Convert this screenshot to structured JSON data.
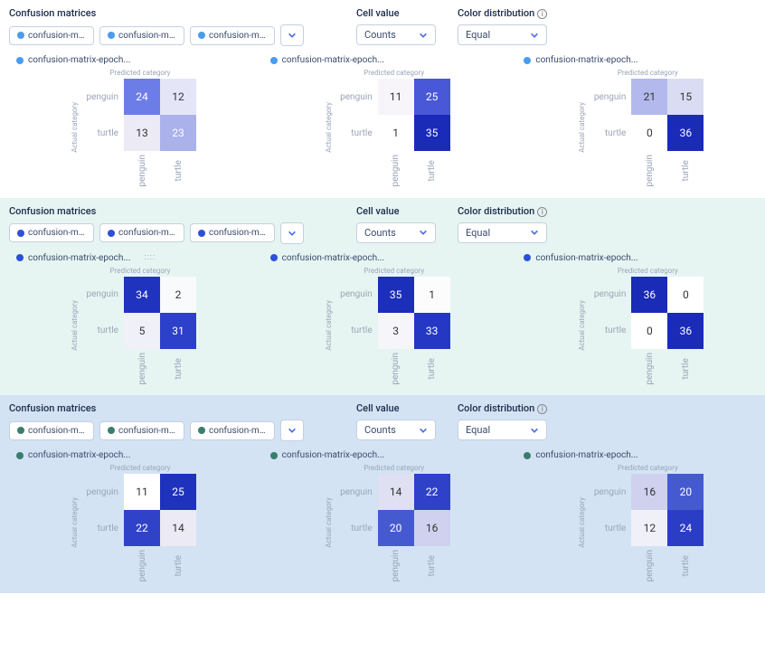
{
  "labels": {
    "confusion_matrices": "Confusion matrices",
    "cell_value": "Cell value",
    "color_distribution": "Color distribution",
    "predicted_category": "Predicted category",
    "actual_category": "Actual category",
    "pill_truncated": "confusion-matri...",
    "matrix_title_truncated": "confusion-matrix-epoch..."
  },
  "selects": {
    "cell_value": "Counts",
    "color_distribution": "Equal"
  },
  "colors": {
    "section1_dot": "#4a9cf0",
    "section2_dot": "#2e4fd9",
    "section3_dot": "#3a7d6f"
  },
  "sections": [
    {
      "bg": "bg-white",
      "dot": "#4a9cf0",
      "matrices": [
        {
          "cells": [
            24,
            12,
            13,
            23
          ],
          "colors": [
            "#6d7de8",
            "#e4e6f7",
            "#eceaf5",
            "#aab1eb"
          ],
          "text": [
            "#fff",
            "#333",
            "#333",
            "#fff"
          ]
        },
        {
          "cells": [
            11,
            25,
            1,
            35
          ],
          "colors": [
            "#f7f4fa",
            "#4858d6",
            "#ffffff",
            "#1a2bb8"
          ],
          "text": [
            "#333",
            "#fff",
            "#333",
            "#fff"
          ]
        },
        {
          "cells": [
            21,
            15,
            0,
            36
          ],
          "colors": [
            "#b3b9ec",
            "#dadcf3",
            "#ffffff",
            "#1a2bb8"
          ],
          "text": [
            "#333",
            "#333",
            "#333",
            "#fff"
          ]
        }
      ]
    },
    {
      "bg": "bg-teal",
      "dot": "#2e4fd9",
      "drag_first": true,
      "matrices": [
        {
          "cells": [
            34,
            2,
            5,
            31
          ],
          "colors": [
            "#1f33bf",
            "#f9fafc",
            "#f0f0f8",
            "#2d40c9"
          ],
          "text": [
            "#fff",
            "#333",
            "#333",
            "#fff"
          ]
        },
        {
          "cells": [
            35,
            1,
            3,
            33
          ],
          "colors": [
            "#1b2fbb",
            "#fcfcfd",
            "#f6f6fa",
            "#2438c3"
          ],
          "text": [
            "#fff",
            "#333",
            "#333",
            "#fff"
          ]
        },
        {
          "cells": [
            36,
            0,
            0,
            36
          ],
          "colors": [
            "#1a2bb8",
            "#ffffff",
            "#ffffff",
            "#1a2bb8"
          ],
          "text": [
            "#fff",
            "#333",
            "#333",
            "#fff"
          ]
        }
      ]
    },
    {
      "bg": "bg-blue",
      "dot": "#3a7d6f",
      "matrices": [
        {
          "cells": [
            11,
            25,
            22,
            14
          ],
          "colors": [
            "#ffffff",
            "#1e32bd",
            "#2f42c8",
            "#eceaf5"
          ],
          "text": [
            "#333",
            "#fff",
            "#fff",
            "#333"
          ]
        },
        {
          "cells": [
            14,
            22,
            20,
            16
          ],
          "colors": [
            "#e0e0f3",
            "#2e41c8",
            "#465ad0",
            "#cfd1ef"
          ],
          "text": [
            "#333",
            "#fff",
            "#fff",
            "#333"
          ]
        },
        {
          "cells": [
            16,
            20,
            12,
            24
          ],
          "colors": [
            "#cfd1ef",
            "#465ad0",
            "#f0f0f8",
            "#2b3dc5"
          ],
          "text": [
            "#333",
            "#fff",
            "#333",
            "#fff"
          ]
        }
      ]
    }
  ],
  "categories": [
    "penguin",
    "turtle"
  ],
  "chart_data": [
    {
      "run": 1,
      "matrix_index": 1,
      "type": "heatmap",
      "title": "confusion-matrix-epoch...",
      "xlabel": "Predicted category",
      "ylabel": "Actual category",
      "x": [
        "penguin",
        "turtle"
      ],
      "y": [
        "penguin",
        "turtle"
      ],
      "values": [
        [
          24,
          12
        ],
        [
          13,
          23
        ]
      ]
    },
    {
      "run": 1,
      "matrix_index": 2,
      "type": "heatmap",
      "title": "confusion-matrix-epoch...",
      "xlabel": "Predicted category",
      "ylabel": "Actual category",
      "x": [
        "penguin",
        "turtle"
      ],
      "y": [
        "penguin",
        "turtle"
      ],
      "values": [
        [
          11,
          25
        ],
        [
          1,
          35
        ]
      ]
    },
    {
      "run": 1,
      "matrix_index": 3,
      "type": "heatmap",
      "title": "confusion-matrix-epoch...",
      "xlabel": "Predicted category",
      "ylabel": "Actual category",
      "x": [
        "penguin",
        "turtle"
      ],
      "y": [
        "penguin",
        "turtle"
      ],
      "values": [
        [
          21,
          15
        ],
        [
          0,
          36
        ]
      ]
    },
    {
      "run": 2,
      "matrix_index": 1,
      "type": "heatmap",
      "title": "confusion-matrix-epoch...",
      "xlabel": "Predicted category",
      "ylabel": "Actual category",
      "x": [
        "penguin",
        "turtle"
      ],
      "y": [
        "penguin",
        "turtle"
      ],
      "values": [
        [
          34,
          2
        ],
        [
          5,
          31
        ]
      ]
    },
    {
      "run": 2,
      "matrix_index": 2,
      "type": "heatmap",
      "title": "confusion-matrix-epoch...",
      "xlabel": "Predicted category",
      "ylabel": "Actual category",
      "x": [
        "penguin",
        "turtle"
      ],
      "y": [
        "penguin",
        "turtle"
      ],
      "values": [
        [
          35,
          1
        ],
        [
          3,
          33
        ]
      ]
    },
    {
      "run": 2,
      "matrix_index": 3,
      "type": "heatmap",
      "title": "confusion-matrix-epoch...",
      "xlabel": "Predicted category",
      "ylabel": "Actual category",
      "x": [
        "penguin",
        "turtle"
      ],
      "y": [
        "penguin",
        "turtle"
      ],
      "values": [
        [
          36,
          0
        ],
        [
          0,
          36
        ]
      ]
    },
    {
      "run": 3,
      "matrix_index": 1,
      "type": "heatmap",
      "title": "confusion-matrix-epoch...",
      "xlabel": "Predicted category",
      "ylabel": "Actual category",
      "x": [
        "penguin",
        "turtle"
      ],
      "y": [
        "penguin",
        "turtle"
      ],
      "values": [
        [
          11,
          25
        ],
        [
          22,
          14
        ]
      ]
    },
    {
      "run": 3,
      "matrix_index": 2,
      "type": "heatmap",
      "title": "confusion-matrix-epoch...",
      "xlabel": "Predicted category",
      "ylabel": "Actual category",
      "x": [
        "penguin",
        "turtle"
      ],
      "y": [
        "penguin",
        "turtle"
      ],
      "values": [
        [
          14,
          22
        ],
        [
          20,
          16
        ]
      ]
    },
    {
      "run": 3,
      "matrix_index": 3,
      "type": "heatmap",
      "title": "confusion-matrix-epoch...",
      "xlabel": "Predicted category",
      "ylabel": "Actual category",
      "x": [
        "penguin",
        "turtle"
      ],
      "y": [
        "penguin",
        "turtle"
      ],
      "values": [
        [
          16,
          20
        ],
        [
          12,
          24
        ]
      ]
    }
  ]
}
